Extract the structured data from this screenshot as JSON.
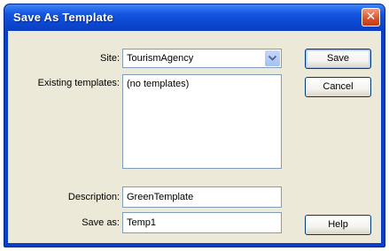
{
  "window": {
    "title": "Save As Template",
    "close_glyph": "✕"
  },
  "form": {
    "site_label": "Site:",
    "site_value": "TourismAgency",
    "existing_label": "Existing templates:",
    "existing_items": [
      "(no templates)"
    ],
    "description_label": "Description:",
    "description_value": "GreenTemplate",
    "saveas_label": "Save as:",
    "saveas_value": "Temp1"
  },
  "buttons": {
    "save": "Save",
    "cancel": "Cancel",
    "help": "Help"
  },
  "colors": {
    "titlebar": "#0c47d2",
    "dialog_bg": "#ece9d8",
    "field_border": "#7f9db9"
  }
}
